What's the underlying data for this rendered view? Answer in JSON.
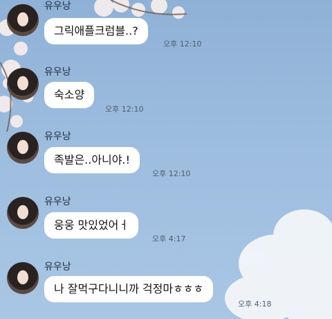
{
  "messages": [
    {
      "sender": "유우낭",
      "text": "그릭애플크럼블..?",
      "time": "오후 12:10"
    },
    {
      "sender": "유우낭",
      "text": "숙소양",
      "time": "오후 12:10"
    },
    {
      "sender": "유우낭",
      "text": "족발은..아니야.!",
      "time": "오후 12:10"
    },
    {
      "sender": "유우낭",
      "text": "웅웅 맛있었어ㅓ",
      "time": "오후 4:17"
    },
    {
      "sender": "유우낭",
      "text": "나 잘먹구다니니까 걱정마ㅎㅎㅎ",
      "time": "오후 4:18"
    }
  ],
  "colors": {
    "bubble": "#ffffff",
    "background": "#9dbddf"
  }
}
